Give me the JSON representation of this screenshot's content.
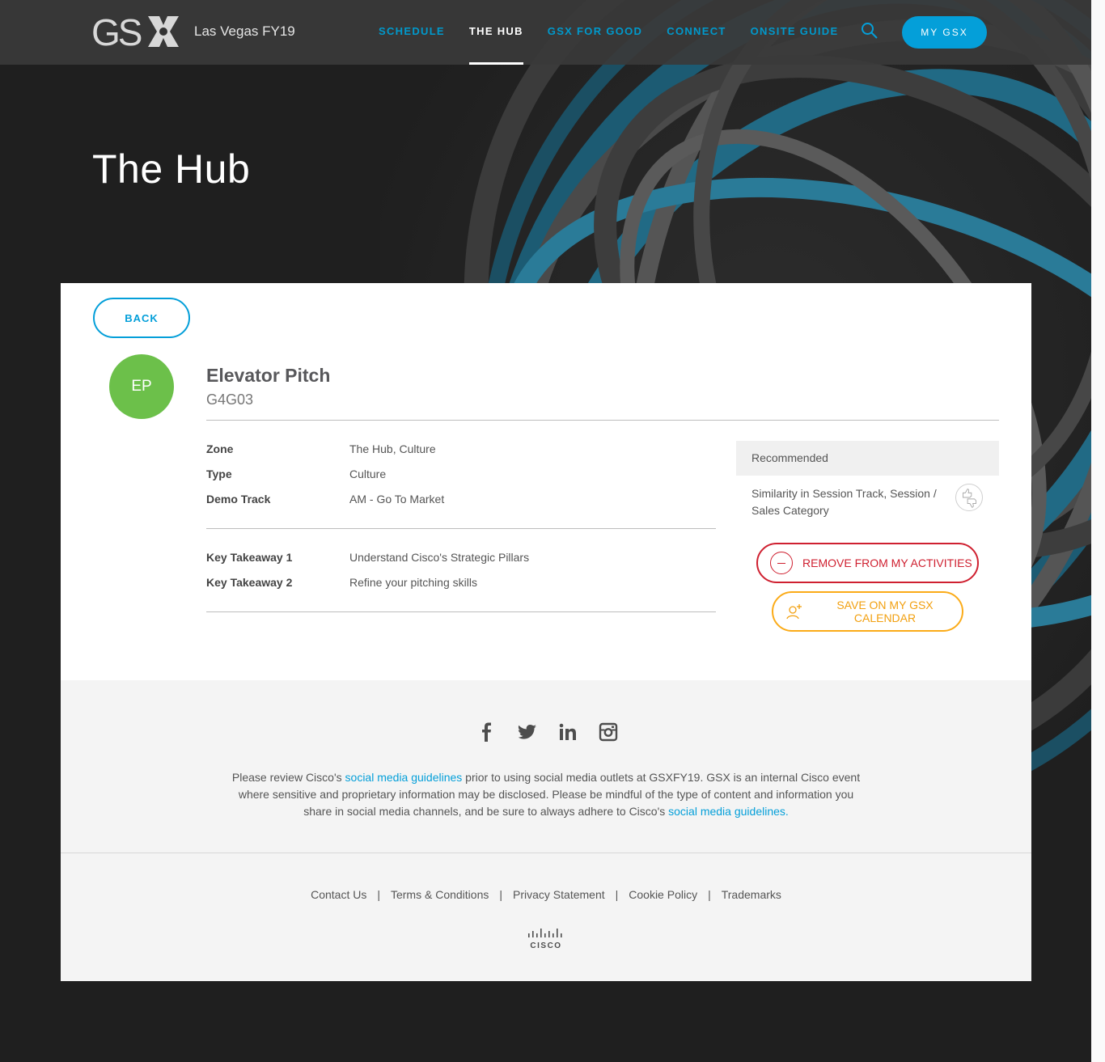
{
  "header": {
    "logo_text": "GSX",
    "event_name": "Las Vegas FY19",
    "nav": [
      {
        "label": "SCHEDULE",
        "active": false
      },
      {
        "label": "THE HUB",
        "active": true
      },
      {
        "label": "GSX FOR GOOD",
        "active": false
      },
      {
        "label": "CONNECT",
        "active": false
      },
      {
        "label": "ONSITE GUIDE",
        "active": false
      }
    ],
    "my_gsx_label": "MY GSX"
  },
  "page_title": "The Hub",
  "session": {
    "back_label": "BACK",
    "avatar_initials": "EP",
    "title": "Elevator Pitch",
    "code": "G4G03",
    "details": [
      {
        "label": "Zone",
        "value": "The Hub, Culture"
      },
      {
        "label": "Type",
        "value": "Culture"
      },
      {
        "label": "Demo Track",
        "value": "AM - Go To Market"
      }
    ],
    "takeaways": [
      {
        "label": "Key Takeaway 1",
        "value": "Understand Cisco's Strategic Pillars"
      },
      {
        "label": "Key Takeaway 2",
        "value": "Refine your pitching skills"
      }
    ],
    "recommended": {
      "heading": "Recommended",
      "reason": "Similarity in Session Track, Session / Sales Category"
    },
    "remove_label": "REMOVE FROM MY ACTIVITIES",
    "save_label": "SAVE ON MY GSX CALENDAR"
  },
  "social": {
    "icons": [
      "facebook-icon",
      "twitter-icon",
      "linkedin-icon",
      "instagram-icon"
    ],
    "disclaimer_part1": "Please review Cisco's ",
    "link1": "social media guidelines",
    "disclaimer_part2": " prior to using social media outlets at GSXFY19. GSX is an internal Cisco event where sensitive and proprietary information may be disclosed. Please be mindful of the type of content and information you share in social media channels, and be sure to always adhere to Cisco's ",
    "link2": "social media guidelines."
  },
  "footer": {
    "links": [
      "Contact Us",
      "Terms & Conditions",
      "Privacy Statement",
      "Cookie Policy",
      "Trademarks"
    ],
    "separator": "|",
    "cisco_wordmark": "CISCO"
  },
  "colors": {
    "accent": "#049fd9",
    "avatar": "#6cc04a",
    "remove": "#cf2030",
    "save": "#fbab18"
  }
}
